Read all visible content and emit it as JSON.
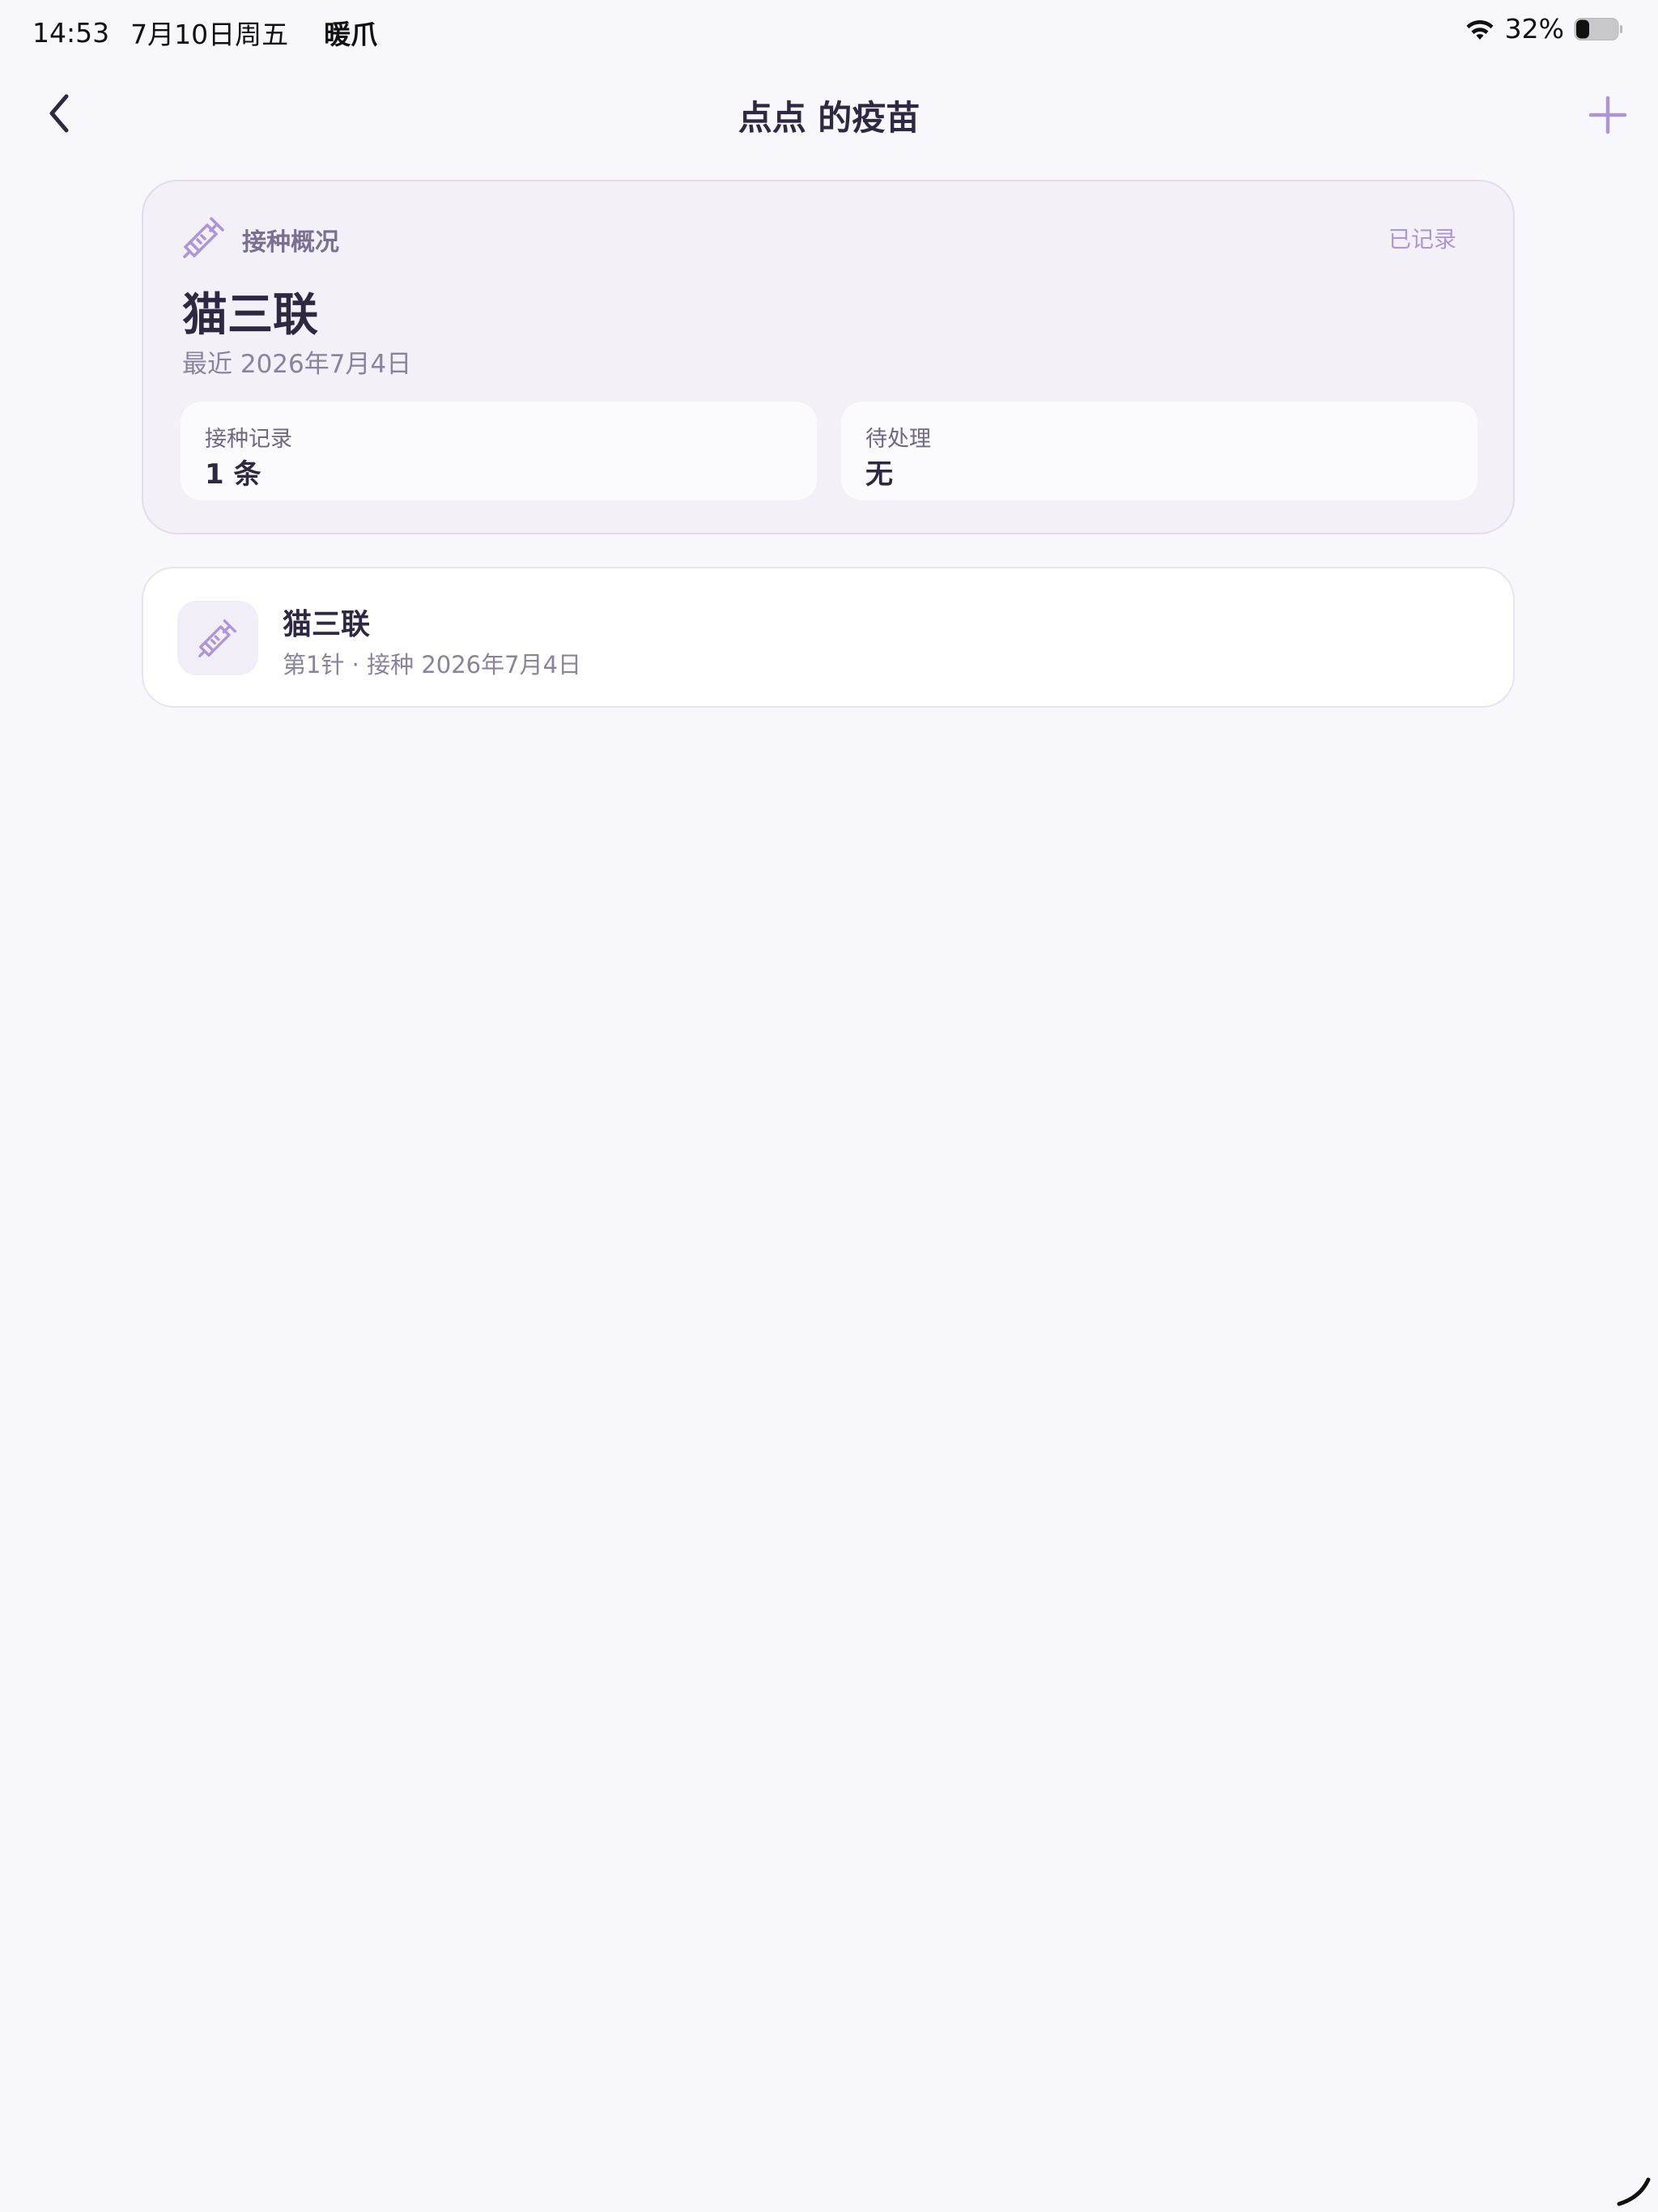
{
  "status_bar": {
    "time": "14:53",
    "date": "7月10日周五",
    "app": "暖爪",
    "battery": "32%",
    "battery_level": 0.32
  },
  "nav": {
    "title": "点点 的疫苗",
    "back_icon": "chevron-left-icon",
    "add_icon": "plus-icon"
  },
  "summary": {
    "icon": "syringe-icon",
    "label": "接种概况",
    "status": "已记录",
    "vaccine_name": "猫三联",
    "recent": "最近 2026年7月4日",
    "stats": [
      {
        "label": "接种记录",
        "value": "1 条"
      },
      {
        "label": "待处理",
        "value": "无"
      }
    ]
  },
  "records": [
    {
      "icon": "syringe-icon",
      "name": "猫三联",
      "detail": "第1针 · 接种 2026年7月4日"
    }
  ],
  "colors": {
    "background": "#f8f7fc",
    "accent": "#ad96d4",
    "text_primary": "#2e2840",
    "text_secondary": "#8a839b",
    "summary_card": "#f3f0f8"
  }
}
